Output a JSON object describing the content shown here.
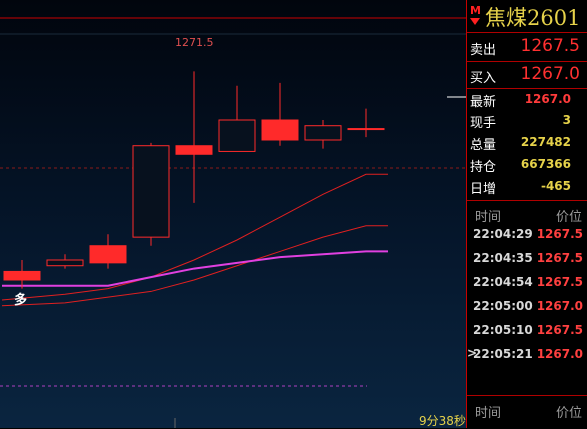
{
  "instrument": {
    "market_flag": "M",
    "name": "焦煤2601",
    "accent_color": "#ff2020",
    "title_color": "#e6d24a"
  },
  "quote": {
    "ask_label": "卖出",
    "ask": "1267.5",
    "bid_label": "买入",
    "bid": "1267.0"
  },
  "stats": [
    {
      "label": "最新",
      "value": "1267.0",
      "color": "#ff3b3b"
    },
    {
      "label": "现手",
      "value": "3",
      "color": "#e6d24a"
    },
    {
      "label": "总量",
      "value": "227482",
      "color": "#e6d24a"
    },
    {
      "label": "持仓",
      "value": "667366",
      "color": "#e6d24a"
    },
    {
      "label": "日增",
      "value": "-465",
      "color": "#e6d24a"
    }
  ],
  "ticks_header": {
    "time": "时间",
    "price": "价位"
  },
  "ticks": [
    {
      "time": "22:04:29",
      "price": "1267.5"
    },
    {
      "time": "22:04:35",
      "price": "1267.5"
    },
    {
      "time": "22:04:54",
      "price": "1267.5"
    },
    {
      "time": "22:05:00",
      "price": "1267.0"
    },
    {
      "time": "22:05:10",
      "price": "1267.5"
    },
    {
      "time": "22:05:21",
      "price": "1267.0"
    }
  ],
  "cursor_symbol": ">",
  "ticks_header_2": {
    "time": "时间",
    "price": "价位"
  },
  "chart": {
    "high_label": "1271.5",
    "signal_label": "多",
    "countdown": "9分38秒"
  },
  "chart_data": {
    "type": "candlestick",
    "y_domain": [
      1262.5,
      1272.3
    ],
    "candles": [
      {
        "open": 1264.2,
        "close": 1263.9,
        "high": 1264.6,
        "low": 1263.6
      },
      {
        "open": 1264.4,
        "close": 1264.6,
        "high": 1264.8,
        "low": 1264.3
      },
      {
        "open": 1265.1,
        "close": 1264.5,
        "high": 1265.5,
        "low": 1264.3
      },
      {
        "open": 1265.4,
        "close": 1268.6,
        "high": 1268.7,
        "low": 1265.1
      },
      {
        "open": 1268.6,
        "close": 1268.3,
        "high": 1271.2,
        "low": 1266.6
      },
      {
        "open": 1268.4,
        "close": 1269.5,
        "high": 1270.7,
        "low": 1268.4
      },
      {
        "open": 1269.5,
        "close": 1268.8,
        "high": 1270.8,
        "low": 1268.6
      },
      {
        "open": 1268.8,
        "close": 1269.3,
        "high": 1269.5,
        "low": 1268.5
      },
      {
        "open": 1269.2,
        "close": 1269.2,
        "high": 1269.9,
        "low": 1268.9
      }
    ],
    "series": [
      {
        "name": "",
        "color": "#e02020",
        "values": [
          1263.2,
          1263.4,
          1263.6,
          1264.0,
          1264.6,
          1265.3,
          1266.1,
          1266.9,
          1267.6
        ]
      },
      {
        "name": "",
        "color": "#e02020",
        "values": [
          1263.0,
          1263.1,
          1263.3,
          1263.5,
          1263.9,
          1264.4,
          1264.9,
          1265.4,
          1265.8
        ]
      },
      {
        "name": "",
        "color": "#e040e0",
        "values": [
          1263.7,
          1263.7,
          1263.7,
          1264.0,
          1264.3,
          1264.5,
          1264.7,
          1264.8,
          1264.9
        ]
      }
    ]
  }
}
